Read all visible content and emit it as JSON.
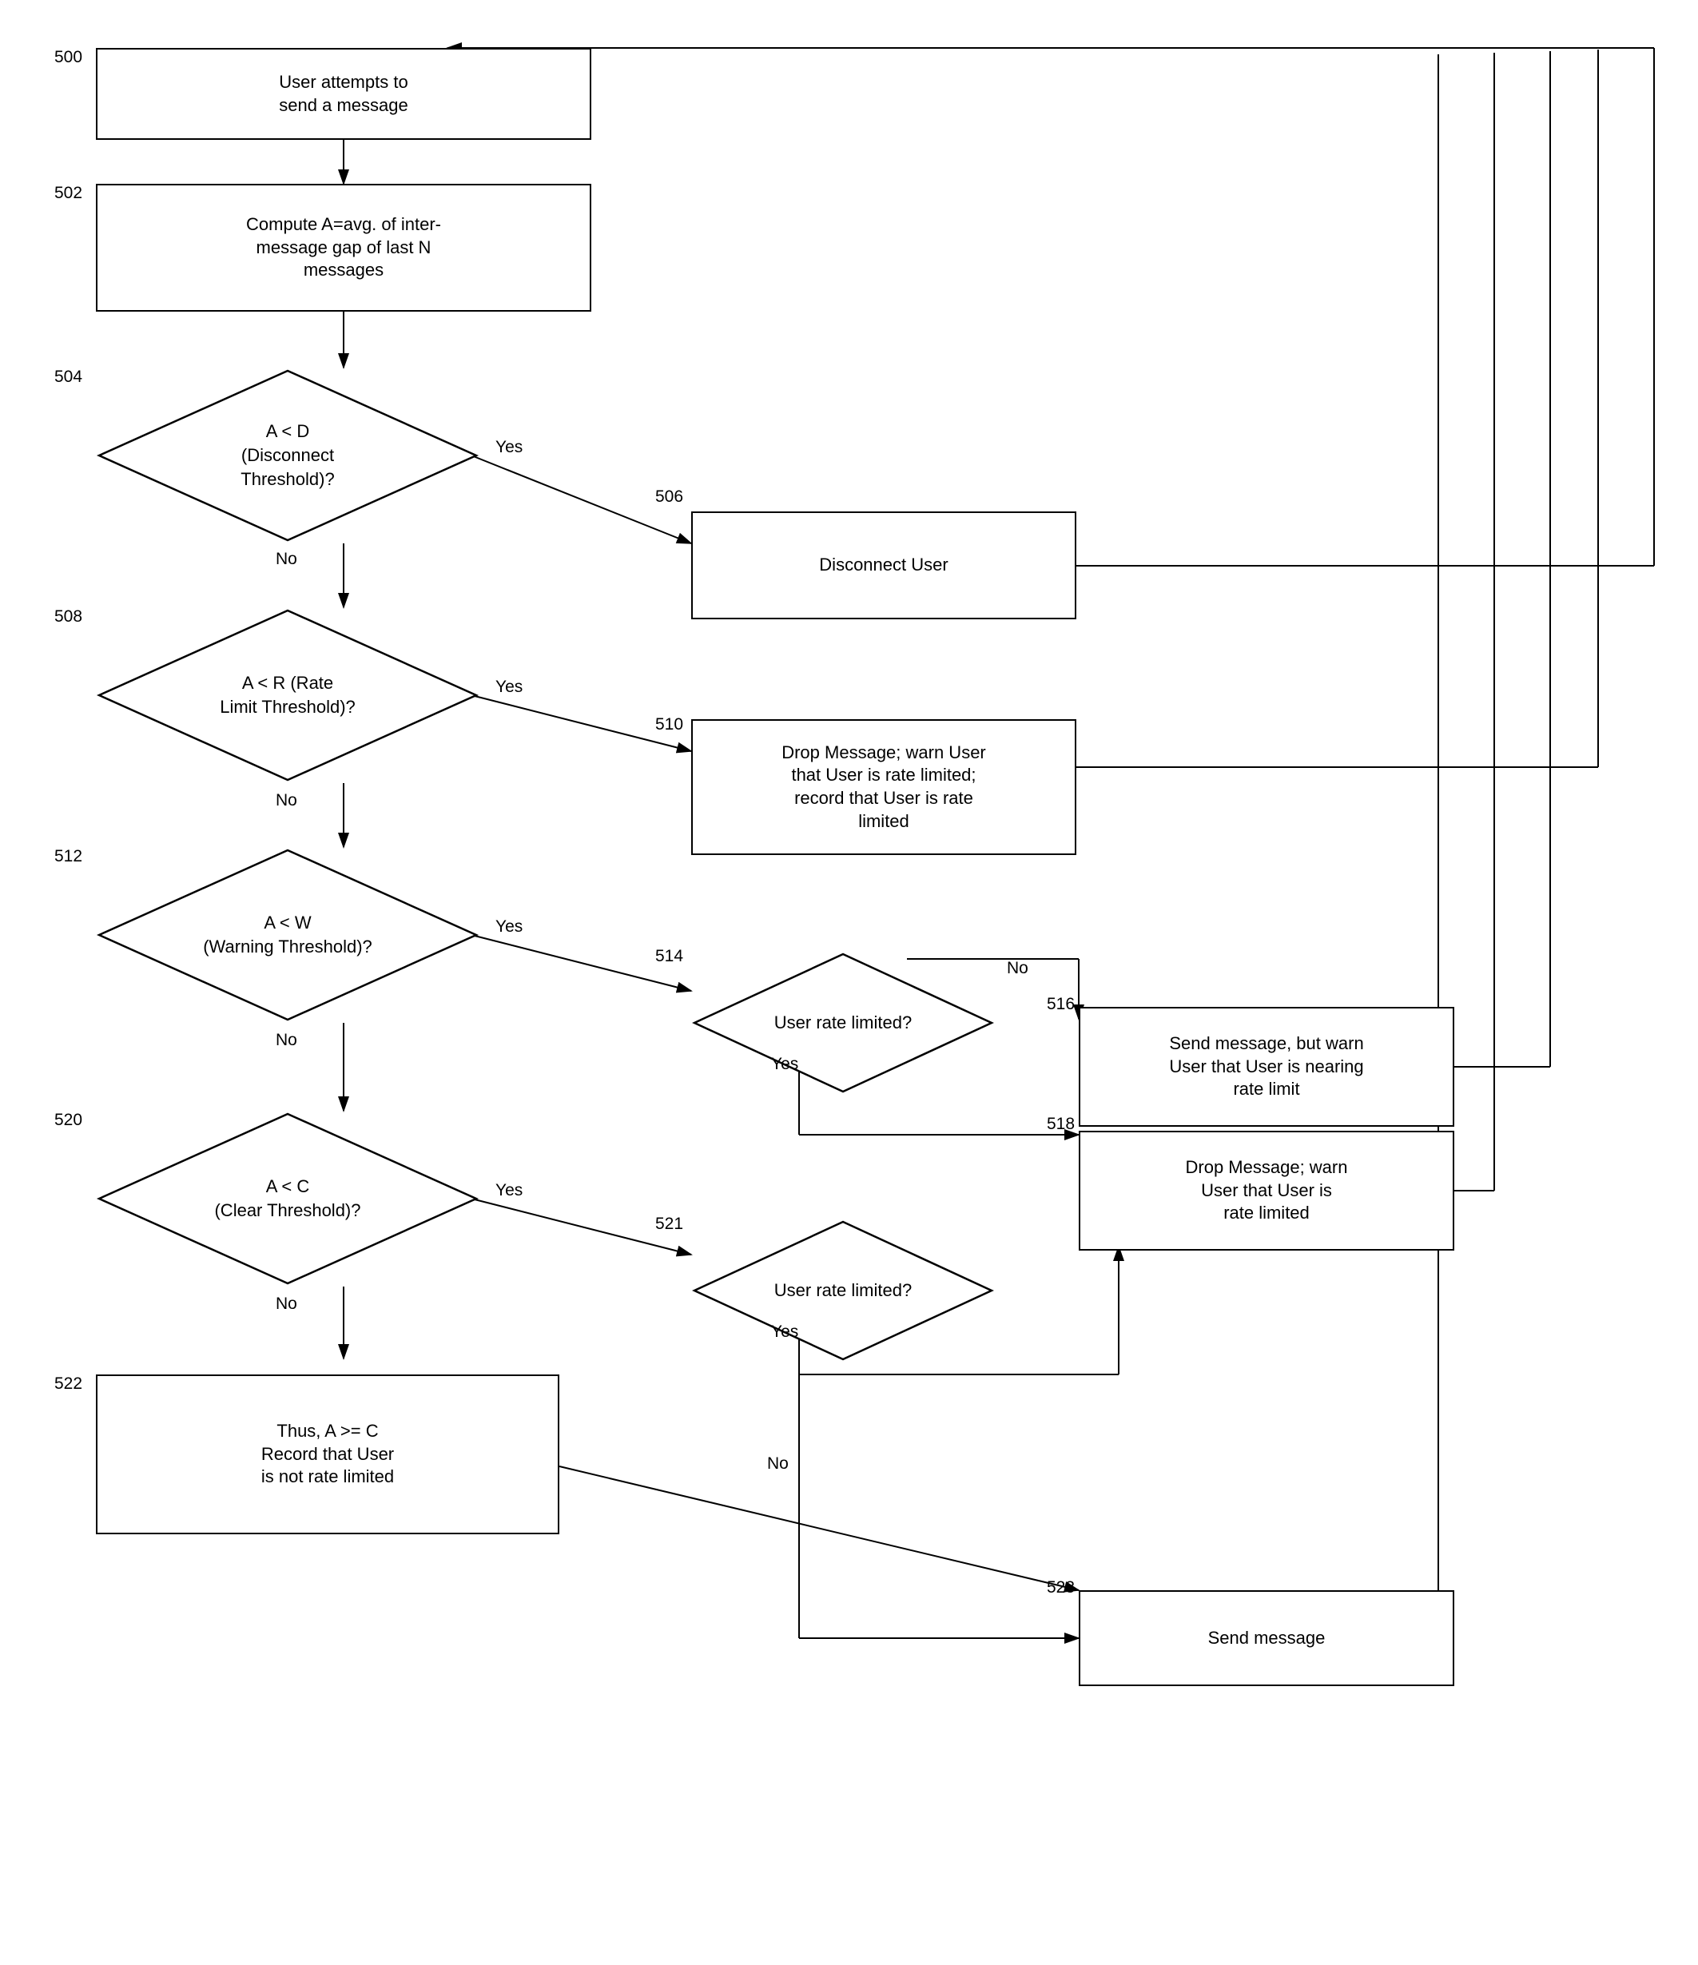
{
  "nodes": {
    "n500_label": "500",
    "n500_text": "User attempts to\nsend a message",
    "n502_label": "502",
    "n502_text": "Compute A=avg. of inter-\nmessage gap of last N\nmessages",
    "n504_label": "504",
    "n504_text": "A < D\n(Disconnect\nThreshold)?",
    "n506_label": "506",
    "n506_text": "Disconnect User",
    "n508_label": "508",
    "n508_text": "A < R (Rate\nLimit Threshold)?",
    "n510_label": "510",
    "n510_text": "Drop Message; warn User\nthat User is rate limited;\nrecord that User is rate\nlimited",
    "n512_label": "512",
    "n512_text": "A < W\n(Warning Threshold)?",
    "n514_label": "514",
    "n514_text": "User rate limited?",
    "n516_label": "516",
    "n516_text": "Send message, but warn\nUser that User is nearing\nrate limit",
    "n518_label": "518",
    "n518_text": "Drop Message; warn\nUser that User is\nrate limited",
    "n520_label": "520",
    "n520_text": "A < C\n(Clear Threshold)?",
    "n521_label": "521",
    "n521_text": "User rate limited?",
    "n522_label": "522",
    "n522_text": "Thus, A >= C\nRecord that User\nis not rate limited",
    "n523_label": "523",
    "n523_text": "Send message",
    "yes": "Yes",
    "no": "No"
  }
}
